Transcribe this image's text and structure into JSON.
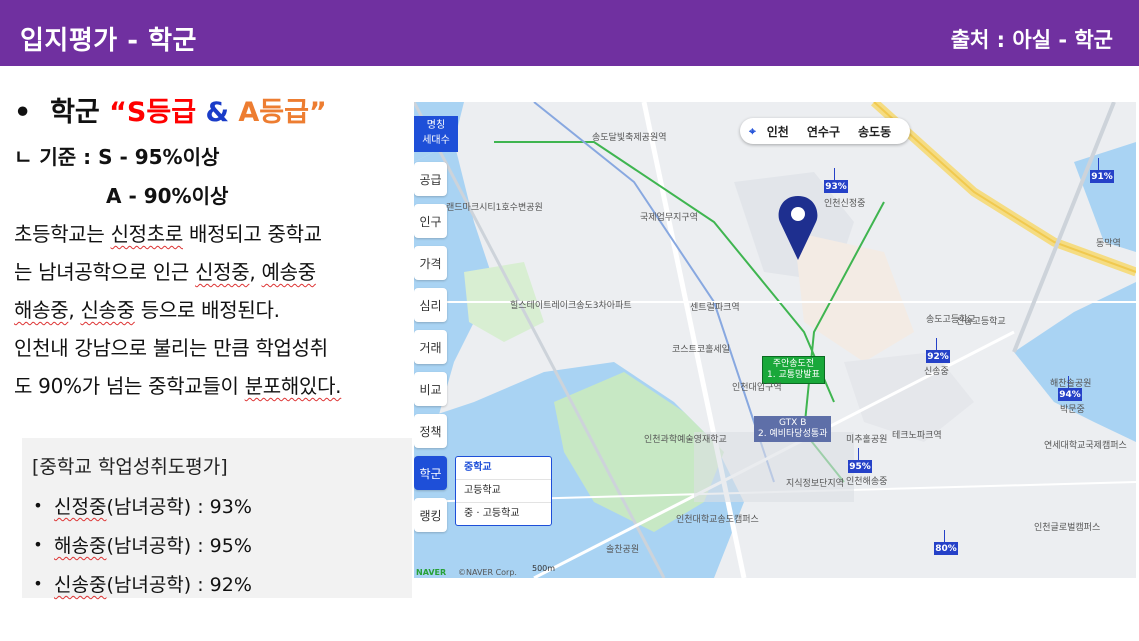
{
  "header": {
    "title": "입지평가 - 학군",
    "source": "출처 : 아실 - 학군"
  },
  "heading": {
    "prefix": "학군",
    "open_quote": "“",
    "s": "S등급",
    "amp": "&",
    "a": "A등급",
    "close_quote": "”"
  },
  "criteria": {
    "label": "ㄴ 기준 : ",
    "s_grade": "S - 95%이상",
    "a_grade": "A - 90%이상"
  },
  "paragraph": {
    "l1a": "초등학교는 ",
    "l1u": "신정초로",
    "l1b": " 배정되고 중학교",
    "l2a": "는 남녀공학으로 인근 ",
    "l2u": "신정중",
    "l2b": ", ",
    "l2u2": "예송중",
    "l3u": "해송중",
    "l3b": ", ",
    "l3u2": "신송중",
    "l3c": " 등으로 배정된다.",
    "l4": "인천내 강남으로 불리는 만큼 학업성취",
    "l5a": "도 90%가 넘는 중학교들이 ",
    "l5u": "분포해있다."
  },
  "evaluation": {
    "title": "[중학교 학업성취도평가]",
    "items": [
      {
        "name": "신정중",
        "detail": " (남녀공학) : 93%"
      },
      {
        "name": "해송중",
        "detail": " (남녀공학) : 95%"
      },
      {
        "name": "신송중",
        "detail": " (남녀공학) : 92%"
      }
    ]
  },
  "map": {
    "segment": {
      "l1": "명칭",
      "l2": "세대수"
    },
    "tools": [
      "공급",
      "인구",
      "가격",
      "심리",
      "거래",
      "비교",
      "정책",
      "학군",
      "랭킹"
    ],
    "active_tool": "학군",
    "school_options": [
      "중학교",
      "고등학교",
      "중 · 고등학교"
    ],
    "region_bar": [
      "인천",
      "연수구",
      "송도동"
    ],
    "badges": [
      "93%",
      "92%",
      "95%",
      "91%",
      "94%",
      "80%"
    ],
    "green_label": {
      "l1": "주안송도전",
      "l2": "1. 교통망발표"
    },
    "gray_label": {
      "l1": "GTX B",
      "l2": "2. 예비타당성통과"
    },
    "place_labels": [
      "송도달빛축제공원역",
      "국제업무지구역",
      "센트럴파크역",
      "인천대입구역",
      "테크노파크역",
      "지식정보단지역",
      "동막역",
      "인천신정중",
      "인천해송중",
      "신송중",
      "인천과학예술영재학교",
      "인천대학교송도캠퍼스",
      "솔찬공원",
      "연세대학교국제캠퍼스",
      "인천글로벌캠퍼스",
      "송도고등학교",
      "힐스테이트레이크송도3차아파트",
      "코스트코홀세일",
      "미추홀공원",
      "박문중",
      "해찬솔공원",
      "랜드마크시티1호수변공원",
      "신송고등학교"
    ],
    "attribution": {
      "naver": "NAVER",
      "copyright": "©NAVER Corp.",
      "scale": "500m"
    }
  }
}
